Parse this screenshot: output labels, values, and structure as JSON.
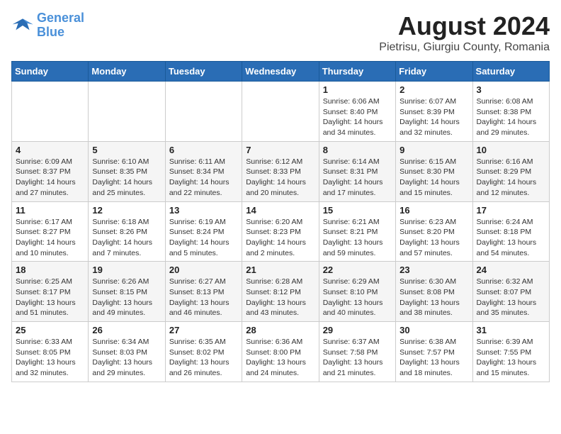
{
  "logo": {
    "line1": "General",
    "line2": "Blue"
  },
  "title": "August 2024",
  "subtitle": "Pietrisu, Giurgiu County, Romania",
  "headers": [
    "Sunday",
    "Monday",
    "Tuesday",
    "Wednesday",
    "Thursday",
    "Friday",
    "Saturday"
  ],
  "weeks": [
    [
      {
        "day": "",
        "info": ""
      },
      {
        "day": "",
        "info": ""
      },
      {
        "day": "",
        "info": ""
      },
      {
        "day": "",
        "info": ""
      },
      {
        "day": "1",
        "info": "Sunrise: 6:06 AM\nSunset: 8:40 PM\nDaylight: 14 hours\nand 34 minutes."
      },
      {
        "day": "2",
        "info": "Sunrise: 6:07 AM\nSunset: 8:39 PM\nDaylight: 14 hours\nand 32 minutes."
      },
      {
        "day": "3",
        "info": "Sunrise: 6:08 AM\nSunset: 8:38 PM\nDaylight: 14 hours\nand 29 minutes."
      }
    ],
    [
      {
        "day": "4",
        "info": "Sunrise: 6:09 AM\nSunset: 8:37 PM\nDaylight: 14 hours\nand 27 minutes."
      },
      {
        "day": "5",
        "info": "Sunrise: 6:10 AM\nSunset: 8:35 PM\nDaylight: 14 hours\nand 25 minutes."
      },
      {
        "day": "6",
        "info": "Sunrise: 6:11 AM\nSunset: 8:34 PM\nDaylight: 14 hours\nand 22 minutes."
      },
      {
        "day": "7",
        "info": "Sunrise: 6:12 AM\nSunset: 8:33 PM\nDaylight: 14 hours\nand 20 minutes."
      },
      {
        "day": "8",
        "info": "Sunrise: 6:14 AM\nSunset: 8:31 PM\nDaylight: 14 hours\nand 17 minutes."
      },
      {
        "day": "9",
        "info": "Sunrise: 6:15 AM\nSunset: 8:30 PM\nDaylight: 14 hours\nand 15 minutes."
      },
      {
        "day": "10",
        "info": "Sunrise: 6:16 AM\nSunset: 8:29 PM\nDaylight: 14 hours\nand 12 minutes."
      }
    ],
    [
      {
        "day": "11",
        "info": "Sunrise: 6:17 AM\nSunset: 8:27 PM\nDaylight: 14 hours\nand 10 minutes."
      },
      {
        "day": "12",
        "info": "Sunrise: 6:18 AM\nSunset: 8:26 PM\nDaylight: 14 hours\nand 7 minutes."
      },
      {
        "day": "13",
        "info": "Sunrise: 6:19 AM\nSunset: 8:24 PM\nDaylight: 14 hours\nand 5 minutes."
      },
      {
        "day": "14",
        "info": "Sunrise: 6:20 AM\nSunset: 8:23 PM\nDaylight: 14 hours\nand 2 minutes."
      },
      {
        "day": "15",
        "info": "Sunrise: 6:21 AM\nSunset: 8:21 PM\nDaylight: 13 hours\nand 59 minutes."
      },
      {
        "day": "16",
        "info": "Sunrise: 6:23 AM\nSunset: 8:20 PM\nDaylight: 13 hours\nand 57 minutes."
      },
      {
        "day": "17",
        "info": "Sunrise: 6:24 AM\nSunset: 8:18 PM\nDaylight: 13 hours\nand 54 minutes."
      }
    ],
    [
      {
        "day": "18",
        "info": "Sunrise: 6:25 AM\nSunset: 8:17 PM\nDaylight: 13 hours\nand 51 minutes."
      },
      {
        "day": "19",
        "info": "Sunrise: 6:26 AM\nSunset: 8:15 PM\nDaylight: 13 hours\nand 49 minutes."
      },
      {
        "day": "20",
        "info": "Sunrise: 6:27 AM\nSunset: 8:13 PM\nDaylight: 13 hours\nand 46 minutes."
      },
      {
        "day": "21",
        "info": "Sunrise: 6:28 AM\nSunset: 8:12 PM\nDaylight: 13 hours\nand 43 minutes."
      },
      {
        "day": "22",
        "info": "Sunrise: 6:29 AM\nSunset: 8:10 PM\nDaylight: 13 hours\nand 40 minutes."
      },
      {
        "day": "23",
        "info": "Sunrise: 6:30 AM\nSunset: 8:08 PM\nDaylight: 13 hours\nand 38 minutes."
      },
      {
        "day": "24",
        "info": "Sunrise: 6:32 AM\nSunset: 8:07 PM\nDaylight: 13 hours\nand 35 minutes."
      }
    ],
    [
      {
        "day": "25",
        "info": "Sunrise: 6:33 AM\nSunset: 8:05 PM\nDaylight: 13 hours\nand 32 minutes."
      },
      {
        "day": "26",
        "info": "Sunrise: 6:34 AM\nSunset: 8:03 PM\nDaylight: 13 hours\nand 29 minutes."
      },
      {
        "day": "27",
        "info": "Sunrise: 6:35 AM\nSunset: 8:02 PM\nDaylight: 13 hours\nand 26 minutes."
      },
      {
        "day": "28",
        "info": "Sunrise: 6:36 AM\nSunset: 8:00 PM\nDaylight: 13 hours\nand 24 minutes."
      },
      {
        "day": "29",
        "info": "Sunrise: 6:37 AM\nSunset: 7:58 PM\nDaylight: 13 hours\nand 21 minutes."
      },
      {
        "day": "30",
        "info": "Sunrise: 6:38 AM\nSunset: 7:57 PM\nDaylight: 13 hours\nand 18 minutes."
      },
      {
        "day": "31",
        "info": "Sunrise: 6:39 AM\nSunset: 7:55 PM\nDaylight: 13 hours\nand 15 minutes."
      }
    ]
  ]
}
